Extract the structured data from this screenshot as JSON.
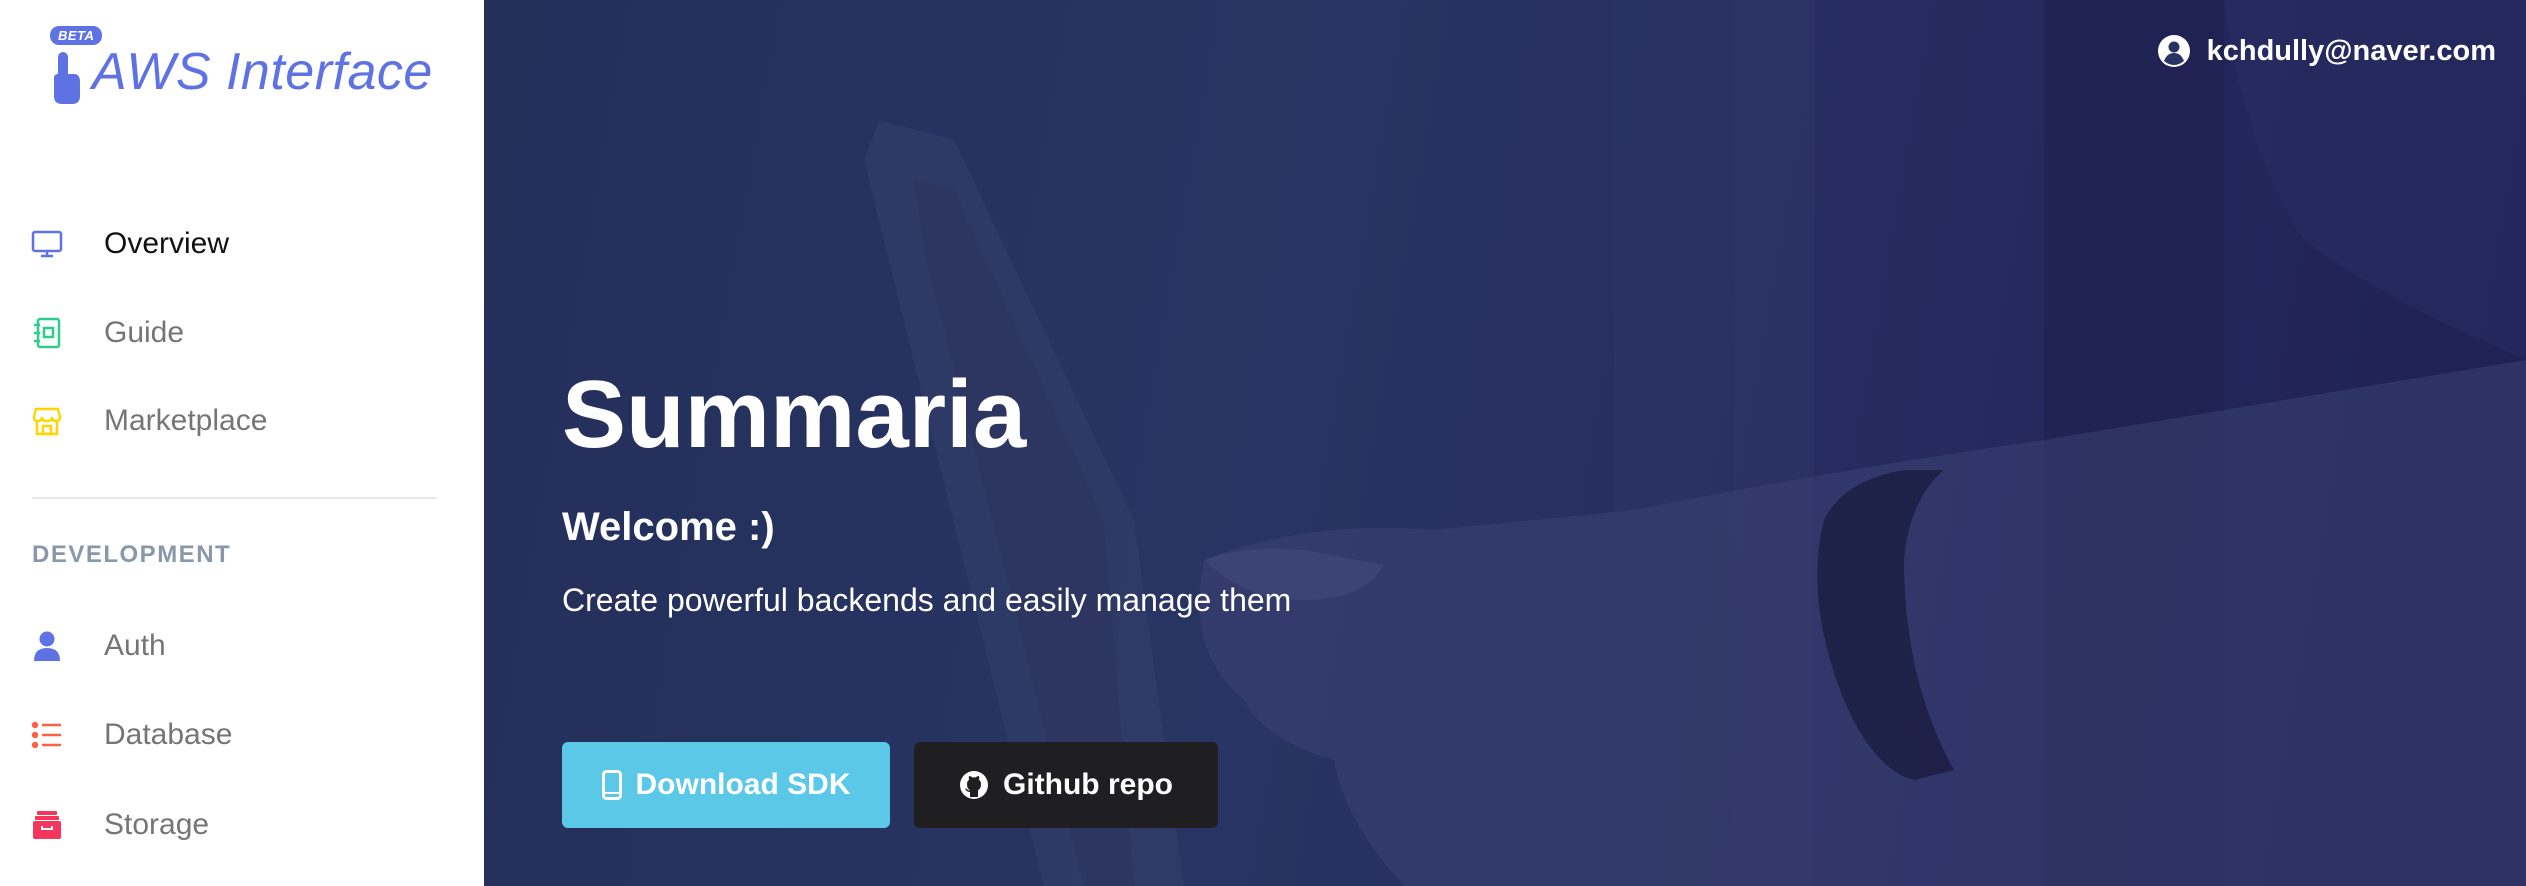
{
  "brand": {
    "badge": "BETA",
    "name": "AWS Interface"
  },
  "nav": {
    "items": [
      {
        "label": "Overview",
        "icon": "monitor-icon"
      },
      {
        "label": "Guide",
        "icon": "notebook-icon"
      },
      {
        "label": "Marketplace",
        "icon": "shop-icon"
      }
    ],
    "section_heading": "DEVELOPMENT",
    "dev_items": [
      {
        "label": "Auth",
        "icon": "user-icon"
      },
      {
        "label": "Database",
        "icon": "list-icon"
      },
      {
        "label": "Storage",
        "icon": "archive-icon"
      }
    ]
  },
  "user": {
    "email": "kchdully@naver.com",
    "icon": "user-circle-icon"
  },
  "hero": {
    "title": "Summaria",
    "subtitle": "Welcome :)",
    "description": "Create powerful backends and easily manage them"
  },
  "buttons": {
    "download_sdk": "Download SDK",
    "github_repo": "Github repo"
  },
  "colors": {
    "accent": "#5e72e4",
    "hero_bg": "#283463",
    "sdk_button": "#5ac8e6",
    "github_button": "#1f1f22",
    "guide_icon": "#2dce89",
    "marketplace_icon": "#ffd600",
    "database_icon": "#fb6340",
    "storage_icon": "#f5365c"
  }
}
